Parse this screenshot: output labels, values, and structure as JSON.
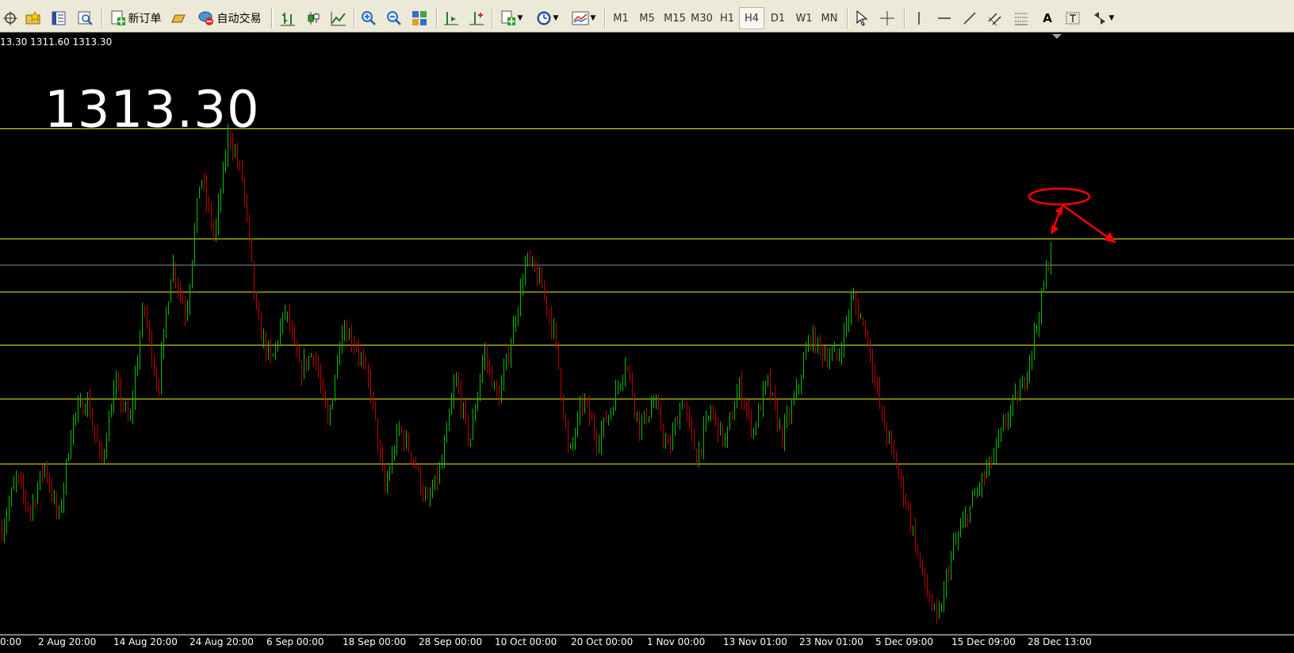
{
  "toolbar": {
    "new_order_label": "新订单",
    "auto_trade_label": "自动交易",
    "timeframes": [
      "M1",
      "M5",
      "M15",
      "M30",
      "H1",
      "H4",
      "D1",
      "W1",
      "MN"
    ],
    "active_timeframe": "H4",
    "text_tool_label": "A"
  },
  "quote_line": "13.30 1311.60 1313.30",
  "big_price": "1313.30",
  "x_ticks": [
    "0:00",
    "2 Aug 20:00",
    "14 Aug 20:00",
    "24 Aug 20:00",
    "6 Sep 00:00",
    "18 Sep 00:00",
    "28 Sep 00:00",
    "10 Oct 00:00",
    "20 Oct 00:00",
    "1 Nov 00:00",
    "13 Nov 01:00",
    "23 Nov 01:00",
    "5 Dec 09:00",
    "15 Dec 09:00",
    "28 Dec 13:00"
  ],
  "colors": {
    "background": "#000000",
    "bull_candle": "#00c000",
    "bear_candle": "#c00000",
    "level_line": "#e6e600",
    "price_line": "#778899",
    "annotation": "#ff0000",
    "text": "#ffffff"
  },
  "chart_data": {
    "type": "candlestick",
    "title": "",
    "xlabel": "",
    "ylabel": "",
    "x_ticks": [
      "0:00",
      "2 Aug 20:00",
      "14 Aug 20:00",
      "24 Aug 20:00",
      "6 Sep 00:00",
      "18 Sep 00:00",
      "28 Sep 00:00",
      "10 Oct 00:00",
      "20 Oct 00:00",
      "1 Nov 00:00",
      "13 Nov 01:00",
      "23 Nov 01:00",
      "5 Dec 09:00",
      "15 Dec 09:00",
      "28 Dec 13:00"
    ],
    "series": [
      {
        "close_path": [
          1218,
          1235,
          1224,
          1240,
          1221,
          1255,
          1262,
          1240,
          1267,
          1253,
          1294,
          1265,
          1308,
          1290,
          1338,
          1316,
          1352,
          1335,
          1288,
          1274,
          1292,
          1271,
          1278,
          1253,
          1287,
          1280,
          1265,
          1231,
          1252,
          1242,
          1226,
          1239,
          1269,
          1247,
          1278,
          1261,
          1284,
          1309,
          1301,
          1283,
          1242,
          1262,
          1248,
          1259,
          1275,
          1252,
          1261,
          1244,
          1262,
          1242,
          1258,
          1247,
          1266,
          1251,
          1268,
          1249,
          1263,
          1283,
          1277,
          1276,
          1296,
          1284,
          1257,
          1241,
          1223,
          1201,
          1186,
          1210,
          1222,
          1233,
          1243,
          1257,
          1266,
          1287,
          1313
        ]
      }
    ],
    "horizontal_levels": [
      1353,
      1316,
      1298,
      1280,
      1262,
      1240
    ],
    "current_price": 1307,
    "ylim": [
      1220,
      1375
    ]
  }
}
